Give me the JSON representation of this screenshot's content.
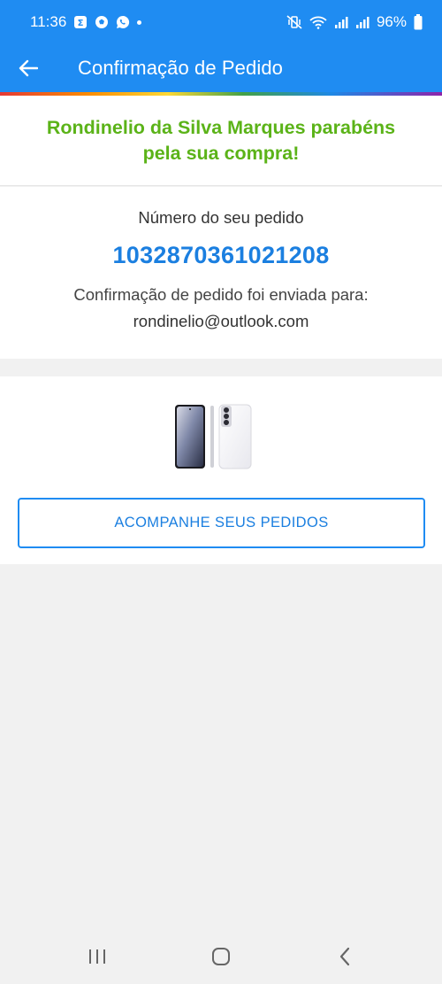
{
  "status_bar": {
    "time": "11:36",
    "battery_pct": "96%",
    "icons": [
      "calendar-icon",
      "soccer-ball-icon",
      "whatsapp-icon",
      "notification-dot",
      "mute-vibrate-icon",
      "wifi-icon",
      "signal-icon",
      "signal-icon",
      "battery-icon"
    ]
  },
  "app_bar": {
    "title": "Confirmação de Pedido",
    "back_icon": "arrow-left-icon"
  },
  "congrats": {
    "message": "Rondinelio da Silva Marques parabéns pela sua compra!"
  },
  "order": {
    "number_label": "Número do seu pedido",
    "number": "1032870361021208",
    "sent_label": "Confirmação de pedido foi enviada para:",
    "email": "rondinelio@outlook.com"
  },
  "product": {
    "image": "smartphone-image",
    "track_button_label": "ACOMPANHE SEUS PEDIDOS"
  },
  "nav_bar": {
    "items": [
      "recent-apps-icon",
      "home-icon",
      "back-icon"
    ]
  },
  "colors": {
    "primary": "#1f8cf2",
    "accent_text": "#1b7fe0",
    "success_green": "#5bb318",
    "background": "#f1f1f1"
  }
}
